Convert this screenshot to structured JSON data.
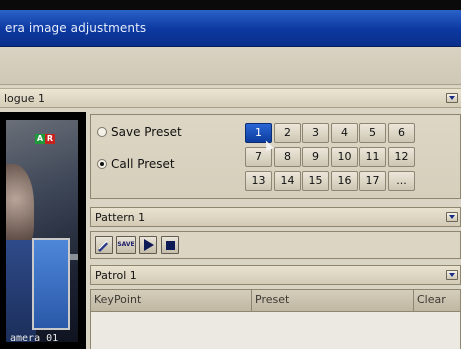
{
  "window": {
    "title": "era image adjustments"
  },
  "channel": {
    "label": "logue 1"
  },
  "camera": {
    "overlay_label": "amera 01",
    "badges": [
      "A",
      "R"
    ]
  },
  "preset": {
    "save_label": "Save Preset",
    "call_label": "Call Preset",
    "selected_mode": "call",
    "buttons": [
      "1",
      "2",
      "3",
      "4",
      "5",
      "6",
      "7",
      "8",
      "9",
      "10",
      "11",
      "12",
      "13",
      "14",
      "15",
      "16",
      "17",
      "..."
    ],
    "selected_button": "1"
  },
  "pattern": {
    "label": "Pattern 1",
    "save_label": "SAVE"
  },
  "patrol": {
    "label": "Patrol 1",
    "columns": [
      "KeyPoint",
      "Preset",
      "Clear"
    ]
  },
  "colors": {
    "title_bar": "#0c38a0",
    "selected": "#1d4fbf",
    "panel": "#dcd5c3"
  }
}
